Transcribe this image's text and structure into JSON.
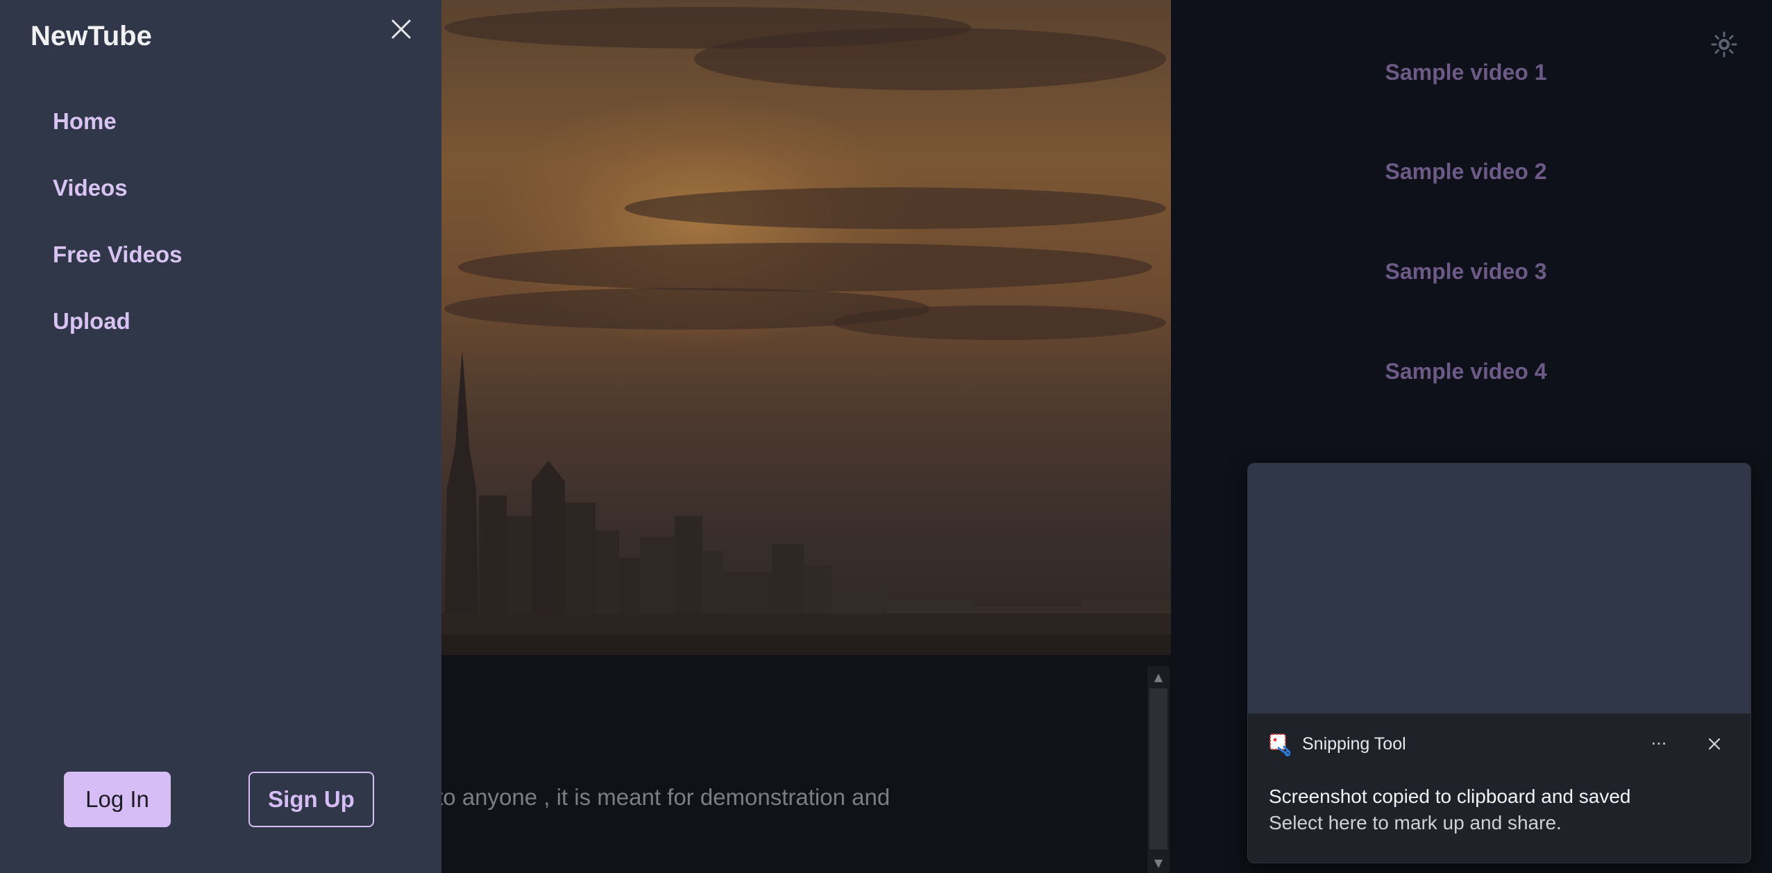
{
  "drawer": {
    "brand": "NewTube",
    "nav": [
      {
        "label": "Home"
      },
      {
        "label": "Videos"
      },
      {
        "label": "Free Videos"
      },
      {
        "label": "Upload"
      }
    ],
    "login_label": "Log In",
    "signup_label": "Sign Up"
  },
  "main": {
    "description_text": "This video is not meant to cause any harm to anyone , it is meant for demonstration and"
  },
  "sidebar": {
    "videos": [
      {
        "label": "Sample video 1"
      },
      {
        "label": "Sample video 2"
      },
      {
        "label": "Sample video 3"
      },
      {
        "label": "Sample video 4"
      }
    ]
  },
  "toast": {
    "app_name": "Snipping Tool",
    "title": "Screenshot copied to clipboard and saved",
    "body": "Select here to mark up and share.",
    "more_glyph": "···"
  },
  "icons": {
    "close": "close-icon",
    "theme": "sun-icon",
    "snipping": "snipping-tool-icon"
  },
  "colors": {
    "drawer_bg": "#2f3748",
    "accent": "#d7bdf5",
    "page_bg": "#0e1119",
    "sample_video_text": "#6d5a86"
  }
}
